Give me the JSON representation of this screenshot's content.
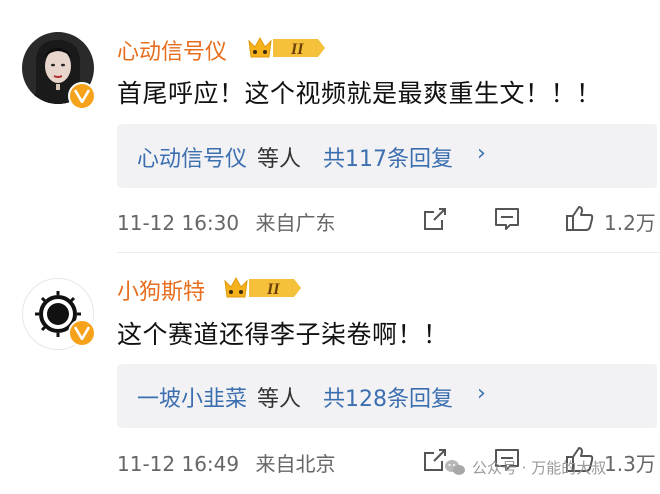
{
  "comments": [
    {
      "username": "心动信号仪",
      "level": "II",
      "text": "首尾呼应！这个视频就是最爽重生文！！！",
      "reply": {
        "name": "心动信号仪",
        "mid": "等人",
        "count": "共117条回复",
        "chevron": "›"
      },
      "time": "11-12 16:30",
      "location": "来自广东",
      "likes": "1.2万"
    },
    {
      "username": "小狗斯特",
      "level": "II",
      "text": "这个赛道还得李子柒卷啊！！",
      "reply": {
        "name": "一坡小韭菜",
        "mid": "等人",
        "count": "共128条回复",
        "chevron": "›"
      },
      "time": "11-12 16:49",
      "location": "来自北京",
      "likes": "1.3万"
    }
  ],
  "watermark": "公众号 · 万能的大叔",
  "colors": {
    "username": "#e86e1f",
    "link": "#3b6fb0",
    "vip_badge": "#f7a21b",
    "level_badge": "#f3b21c"
  },
  "icons": [
    "share-icon",
    "comment-icon",
    "like-icon",
    "vip-v-icon",
    "crown-icon",
    "wechat-icon"
  ]
}
